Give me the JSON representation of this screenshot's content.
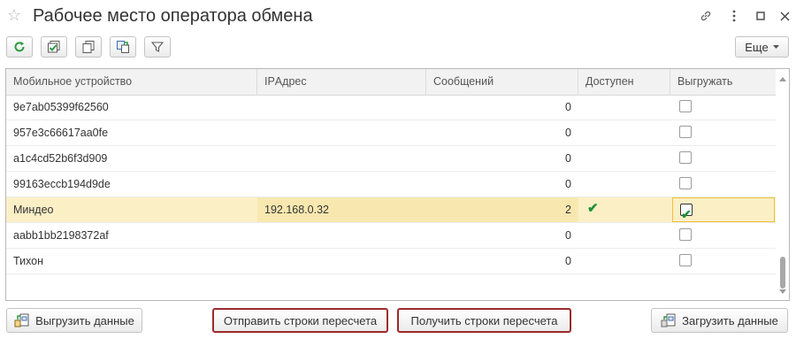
{
  "window": {
    "title": "Рабочее место оператора обмена"
  },
  "toolbar": {
    "more_label": "Еще"
  },
  "table": {
    "columns": [
      "Мобильное устройство",
      "IPАдрес",
      "Сообщений",
      "Доступен",
      "Выгружать"
    ],
    "rows": [
      {
        "device": "9e7ab05399f62560",
        "ip": "",
        "messages": "0",
        "available": false,
        "upload": false
      },
      {
        "device": "957e3c66617aa0fe",
        "ip": "",
        "messages": "0",
        "available": false,
        "upload": false
      },
      {
        "device": "a1c4cd52b6f3d909",
        "ip": "",
        "messages": "0",
        "available": false,
        "upload": false
      },
      {
        "device": "99163eccb194d9de",
        "ip": "",
        "messages": "0",
        "available": false,
        "upload": false
      },
      {
        "device": "Миндео",
        "ip": "192.168.0.32",
        "messages": "2",
        "available": true,
        "upload": true
      },
      {
        "device": "aabb1bb2198372af",
        "ip": "",
        "messages": "0",
        "available": false,
        "upload": false
      },
      {
        "device": "Тихон",
        "ip": "",
        "messages": "0",
        "available": false,
        "upload": false
      }
    ]
  },
  "buttons": {
    "upload_data": "Выгрузить данные",
    "send_rows": "Отправить строки пересчета",
    "receive_rows": "Получить строки пересчета",
    "load_data": "Загрузить данные"
  }
}
